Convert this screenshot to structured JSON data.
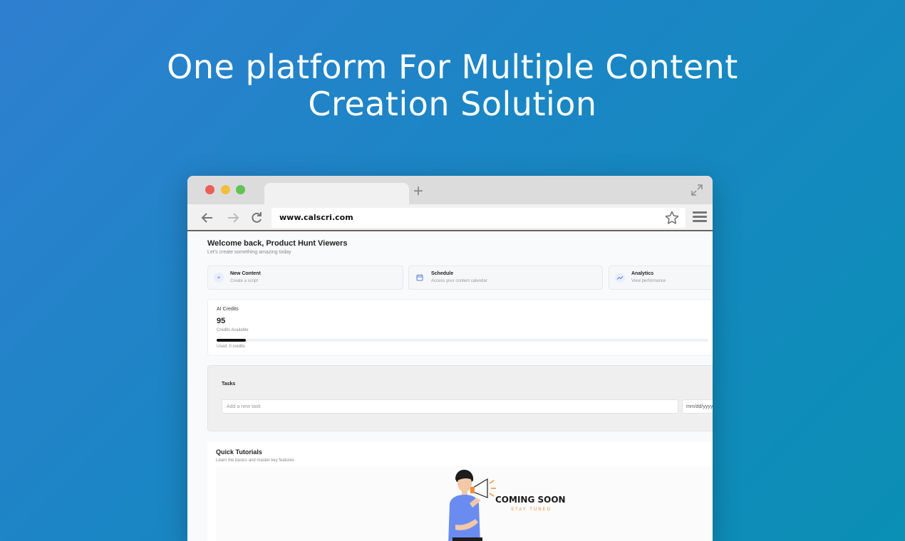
{
  "hero": {
    "line1": "One platform For Multiple Content",
    "line2": "Creation Solution"
  },
  "browser": {
    "url": "www.calscri.com",
    "new_tab": "+"
  },
  "dashboard": {
    "welcome": "Welcome back, Product Hunt Viewers",
    "welcome_sub": "Let's create something amazing today",
    "actions": [
      {
        "title": "New Content",
        "subtitle": "Create a script",
        "icon": "plus-icon"
      },
      {
        "title": "Schedule",
        "subtitle": "Access your content calendar",
        "icon": "calendar-icon"
      },
      {
        "title": "Analytics",
        "subtitle": "View performance",
        "icon": "trending-icon"
      }
    ],
    "credits": {
      "label": "AI Credits",
      "value": "95",
      "sub": "Credits Available",
      "used": "Used: 0 credits",
      "progress_fraction": 0.06
    },
    "tasks": {
      "title": "Tasks",
      "placeholder": "Add a new task",
      "date_placeholder": "mm/dd/yyyy"
    },
    "tutorials": {
      "title": "Quick Tutorials",
      "subtitle": "Learn the basics and master key features",
      "coming_soon": "COMING SOON",
      "stay_tuned": "STAY TUNED"
    }
  },
  "colors": {
    "accent": "#5b7fd6",
    "coming_soon_accent": "#f28b3c"
  }
}
